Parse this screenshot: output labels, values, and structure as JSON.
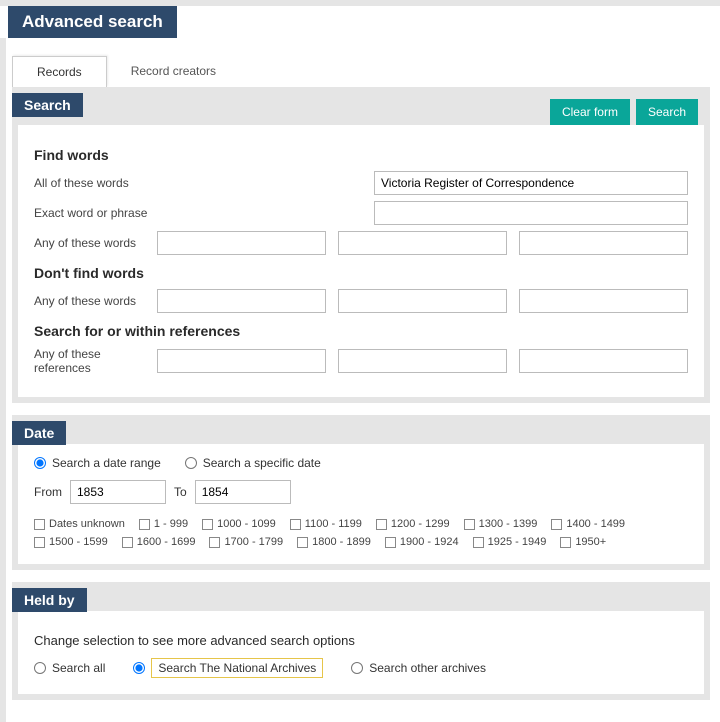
{
  "page_title": "Advanced search",
  "tabs": {
    "records": "Records",
    "creators": "Record creators"
  },
  "search": {
    "header": "Search",
    "clear": "Clear form",
    "search_btn": "Search",
    "find_words": "Find words",
    "all_label": "All of these words",
    "all_value": "Victoria Register of Correspondence",
    "exact_label": "Exact word or phrase",
    "any_label": "Any of these words",
    "dont_find": "Don't find words",
    "dont_any_label": "Any of these words",
    "refs_hdr": "Search for or within references",
    "refs_label": "Any of these references"
  },
  "date": {
    "header": "Date",
    "range_label": "Search a date range",
    "specific_label": "Search a specific date",
    "from_lbl": "From",
    "from_val": "1853",
    "to_lbl": "To",
    "to_val": "1854",
    "checks": [
      "Dates unknown",
      "1 - 999",
      "1000 - 1099",
      "1100 - 1199",
      "1200 - 1299",
      "1300 - 1399",
      "1400 - 1499",
      "1500 - 1599",
      "1600 - 1699",
      "1700 - 1799",
      "1800 - 1899",
      "1900 - 1924",
      "1925 - 1949",
      "1950+"
    ]
  },
  "held": {
    "header": "Held by",
    "sub": "Change selection to see more advanced search options",
    "all": "Search all",
    "tna": "Search The National Archives",
    "other": "Search other archives"
  }
}
